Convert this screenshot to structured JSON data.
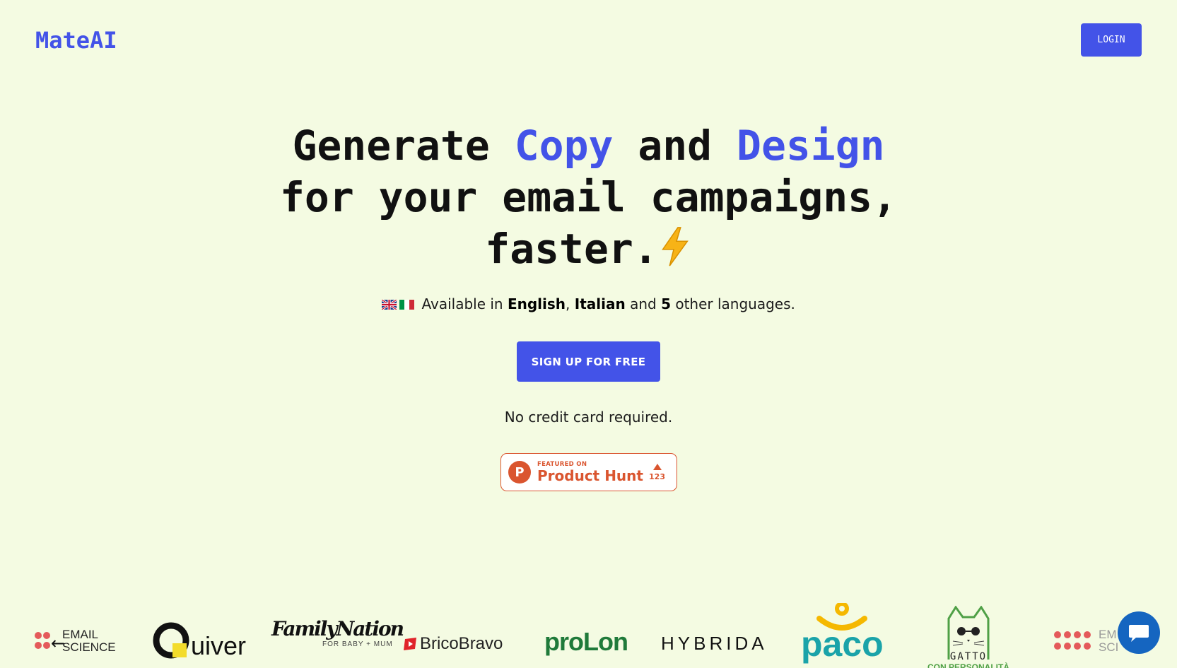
{
  "header": {
    "brand": "MateAI",
    "login_label": "LOGIN"
  },
  "hero": {
    "line1_a": "Generate ",
    "line1_accent1": "Copy",
    "line1_b": " and ",
    "line1_accent2": "Design",
    "line2": "for your email campaigns,",
    "line3": "faster.",
    "bolt_icon": "lightning-icon"
  },
  "languages": {
    "prefix": "Available in ",
    "lang1": "English",
    "sep": ", ",
    "lang2": "Italian",
    "and": " and ",
    "count": "5",
    "suffix": " other languages."
  },
  "cta": {
    "signup_label": "SIGN UP FOR FREE",
    "no_card": "No credit card required."
  },
  "product_hunt": {
    "featured": "FEATURED ON",
    "name": "Product Hunt",
    "votes": "123",
    "logo_letter": "P"
  },
  "logos": {
    "email_science_1": "EMAIL",
    "email_science_2": "SCIENCE",
    "quiver": "uiver",
    "family_nation": "FamilyNation",
    "family_nation_sub": "FOR BABY + MUM",
    "brico": "BricoBravo",
    "prolon": "proLon",
    "hybrida": "HYBRIDA",
    "paco": "paco",
    "gatto_1": "GATTO",
    "gatto_2": "CON PERSONALITÀ",
    "email_science_3": "EM",
    "email_science_4": "SCI"
  },
  "colors": {
    "background": "#f4fbe2",
    "accent": "#4353e8",
    "product_hunt": "#da552f",
    "chat": "#1565c0"
  }
}
